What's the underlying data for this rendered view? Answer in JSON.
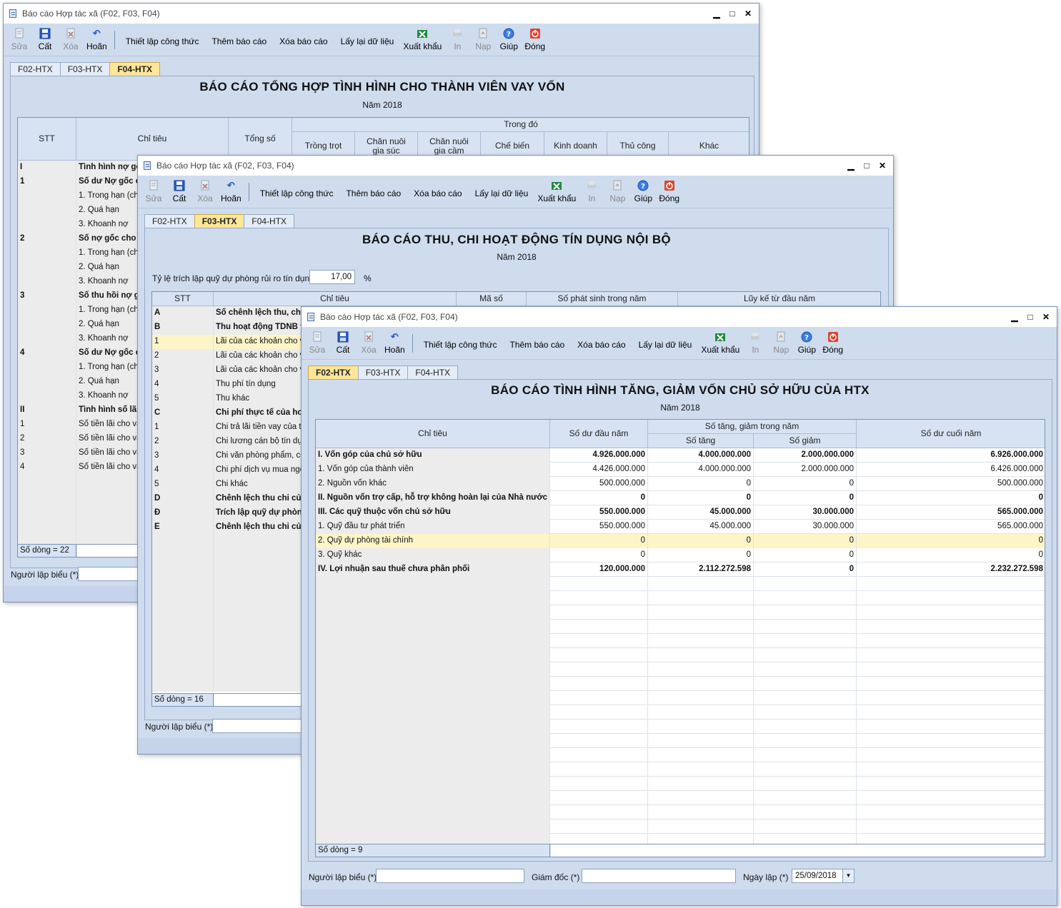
{
  "window_title": "Báo cáo Hợp tác xã (F02, F03, F04)",
  "toolbar": {
    "edit": "Sửa",
    "save": "Cất",
    "delete": "Xóa",
    "undo": "Hoãn",
    "formula": "Thiết lập công thức",
    "add_report": "Thêm báo cáo",
    "delete_report": "Xóa báo cáo",
    "reload": "Lấy lại dữ liệu",
    "export": "Xuất khẩu",
    "print": "In",
    "load": "Nạp",
    "help": "Giúp",
    "close": "Đóng"
  },
  "tabs": [
    "F02-HTX",
    "F03-HTX",
    "F04-HTX"
  ],
  "w1": {
    "title": "BÁO CÁO TỔNG HỢP TÌNH HÌNH CHO THÀNH VIÊN VAY VỐN",
    "year": "Năm 2018",
    "headers": {
      "stt": "STT",
      "chitieu": "Chỉ tiêu",
      "tongso": "Tổng số",
      "trongdo": "Trong đó",
      "trongtrot": "Trồng trọt",
      "channuoi_gs_1": "Chăn nuôi",
      "channuoi_gs_2": "gia súc",
      "channuoi_gc_1": "Chăn nuôi",
      "channuoi_gc_2": "gia cầm",
      "chebien": "Chế biến",
      "kinhdoanh": "Kinh doanh",
      "thucong": "Thủ công",
      "khac": "Khác"
    },
    "rows": [
      {
        "stt": "I",
        "text": "Tình hình nợ gố",
        "bold": true
      },
      {
        "stt": "1",
        "text": "Số dư Nợ gốc c",
        "bold": true
      },
      {
        "stt": "",
        "text": "1. Trong hạn (ch",
        "bold": false
      },
      {
        "stt": "",
        "text": "2. Quá hạn",
        "bold": false
      },
      {
        "stt": "",
        "text": "3. Khoanh nợ",
        "bold": false
      },
      {
        "stt": "2",
        "text": "Số nợ gốc cho v",
        "bold": true
      },
      {
        "stt": "",
        "text": "1. Trong hạn (ch",
        "bold": false
      },
      {
        "stt": "",
        "text": "2. Quá hạn",
        "bold": false
      },
      {
        "stt": "",
        "text": "3. Khoanh nợ",
        "bold": false
      },
      {
        "stt": "3",
        "text": "Số thu hồi nợ gố",
        "bold": true
      },
      {
        "stt": "",
        "text": "1. Trong hạn (ch",
        "bold": false
      },
      {
        "stt": "",
        "text": "2. Quá hạn",
        "bold": false
      },
      {
        "stt": "",
        "text": "3. Khoanh nợ",
        "bold": false
      },
      {
        "stt": "4",
        "text": "Số dư Nợ gốc c",
        "bold": true
      },
      {
        "stt": "",
        "text": "1. Trong hạn (ch",
        "bold": false
      },
      {
        "stt": "",
        "text": "2. Quá hạn",
        "bold": false
      },
      {
        "stt": "",
        "text": "3. Khoanh nợ",
        "bold": false
      },
      {
        "stt": "II",
        "text": "Tình hình số lãi",
        "bold": true
      },
      {
        "stt": "1",
        "text": "Số tiền lãi cho va",
        "bold": false
      },
      {
        "stt": "2",
        "text": "Số tiền lãi cho va",
        "bold": false
      },
      {
        "stt": "3",
        "text": "Số tiền lãi cho va",
        "bold": false
      },
      {
        "stt": "4",
        "text": "Số tiền lãi cho va",
        "bold": false
      }
    ],
    "row_count": "Số dòng = 22",
    "preparer_label": "Người lập biểu (*)"
  },
  "w2": {
    "title": "BÁO CÁO THU, CHI HOẠT ĐỘNG TÍN DỤNG NỘI BỘ",
    "year": "Năm 2018",
    "rate_label": "Tỷ lệ trích lập quỹ dự phòng rủi ro tín dụng",
    "rate_value": "17,00",
    "rate_unit": "%",
    "headers": {
      "stt": "STT",
      "chitieu": "Chỉ tiêu",
      "maso": "Mã số",
      "phatsinh": "Số phát sinh trong năm",
      "luyke": "Lũy kế từ đầu năm"
    },
    "rows": [
      {
        "stt": "A",
        "text": "Số chênh lệch thu, chi",
        "bold": true
      },
      {
        "stt": "B",
        "text": "Thu hoạt động TDNB t",
        "bold": true
      },
      {
        "stt": "1",
        "text": "Lãi của các khoản cho v",
        "bold": false,
        "sel": true
      },
      {
        "stt": "2",
        "text": "Lãi của các khoản cho v",
        "bold": false
      },
      {
        "stt": "3",
        "text": "Lãi của các khoản cho v",
        "bold": false
      },
      {
        "stt": "4",
        "text": "Thu phí tín dụng",
        "bold": false
      },
      {
        "stt": "5",
        "text": "Thu khác",
        "bold": false
      },
      {
        "stt": "C",
        "text": "Chi phí thực tế của ho",
        "bold": true
      },
      {
        "stt": "1",
        "text": "Chi trả lãi tiền vay của tl",
        "bold": false
      },
      {
        "stt": "2",
        "text": "Chi lương cán bộ tín dụn",
        "bold": false
      },
      {
        "stt": "3",
        "text": "Chi văn phòng phẩm, cô",
        "bold": false
      },
      {
        "stt": "4",
        "text": "Chi phí dịch vụ mua ngo",
        "bold": false
      },
      {
        "stt": "5",
        "text": "Chi khác",
        "bold": false
      },
      {
        "stt": "D",
        "text": "Chênh lệch thu chi củ",
        "bold": true
      },
      {
        "stt": "Đ",
        "text": "Trích lập quỹ dự phòn",
        "bold": true
      },
      {
        "stt": "E",
        "text": "Chênh lệch thu chi củ",
        "bold": true
      }
    ],
    "row_count": "Số dòng = 16",
    "preparer_label": "Người lập biểu (*)"
  },
  "w3": {
    "title": "BÁO CÁO TÌNH HÌNH TĂNG, GIẢM VỐN CHỦ SỞ HỮU CỦA HTX",
    "year": "Năm 2018",
    "headers": {
      "chitieu": "Chỉ tiêu",
      "dau_nam": "Số dư đầu năm",
      "tang_giam": "Số tăng, giảm trong năm",
      "so_tang": "Số tăng",
      "so_giam": "Số giảm",
      "cuoi_nam": "Số dư cuối năm"
    },
    "rows": [
      {
        "text": "I. Vốn góp của chủ sở hữu",
        "dau": "4.926.000.000",
        "tang": "4.000.000.000",
        "giam": "2.000.000.000",
        "cuoi": "6.926.000.000",
        "bold": true
      },
      {
        "text": "1. Vốn góp của thành viên",
        "dau": "4.426.000.000",
        "tang": "4.000.000.000",
        "giam": "2.000.000.000",
        "cuoi": "6.426.000.000",
        "bold": false
      },
      {
        "text": "2. Nguồn vốn khác",
        "dau": "500.000.000",
        "tang": "0",
        "giam": "0",
        "cuoi": "500.000.000",
        "bold": false
      },
      {
        "text": "II. Nguồn vốn trợ cấp, hỗ trợ không hoàn lại của Nhà nước",
        "dau": "0",
        "tang": "0",
        "giam": "0",
        "cuoi": "0",
        "bold": true
      },
      {
        "text": "III. Các quỹ thuộc vốn chủ sở hữu",
        "dau": "550.000.000",
        "tang": "45.000.000",
        "giam": "30.000.000",
        "cuoi": "565.000.000",
        "bold": true
      },
      {
        "text": "1. Quỹ đầu tư phát triển",
        "dau": "550.000.000",
        "tang": "45.000.000",
        "giam": "30.000.000",
        "cuoi": "565.000.000",
        "bold": false
      },
      {
        "text": "2. Quỹ dự phòng tài chính",
        "dau": "0",
        "tang": "0",
        "giam": "0",
        "cuoi": "0",
        "bold": false,
        "sel": true
      },
      {
        "text": "3. Quỹ khác",
        "dau": "0",
        "tang": "0",
        "giam": "0",
        "cuoi": "0",
        "bold": false
      },
      {
        "text": "IV. Lợi nhuận sau thuế chưa phân phối",
        "dau": "120.000.000",
        "tang": "2.112.272.598",
        "giam": "0",
        "cuoi": "2.232.272.598",
        "bold": true
      }
    ],
    "row_count": "Số dòng = 9",
    "preparer_label": "Người lập biểu (*)",
    "director_label": "Giám đốc (*)",
    "date_label": "Ngày lập (*)",
    "date_value": "25/09/2018"
  }
}
